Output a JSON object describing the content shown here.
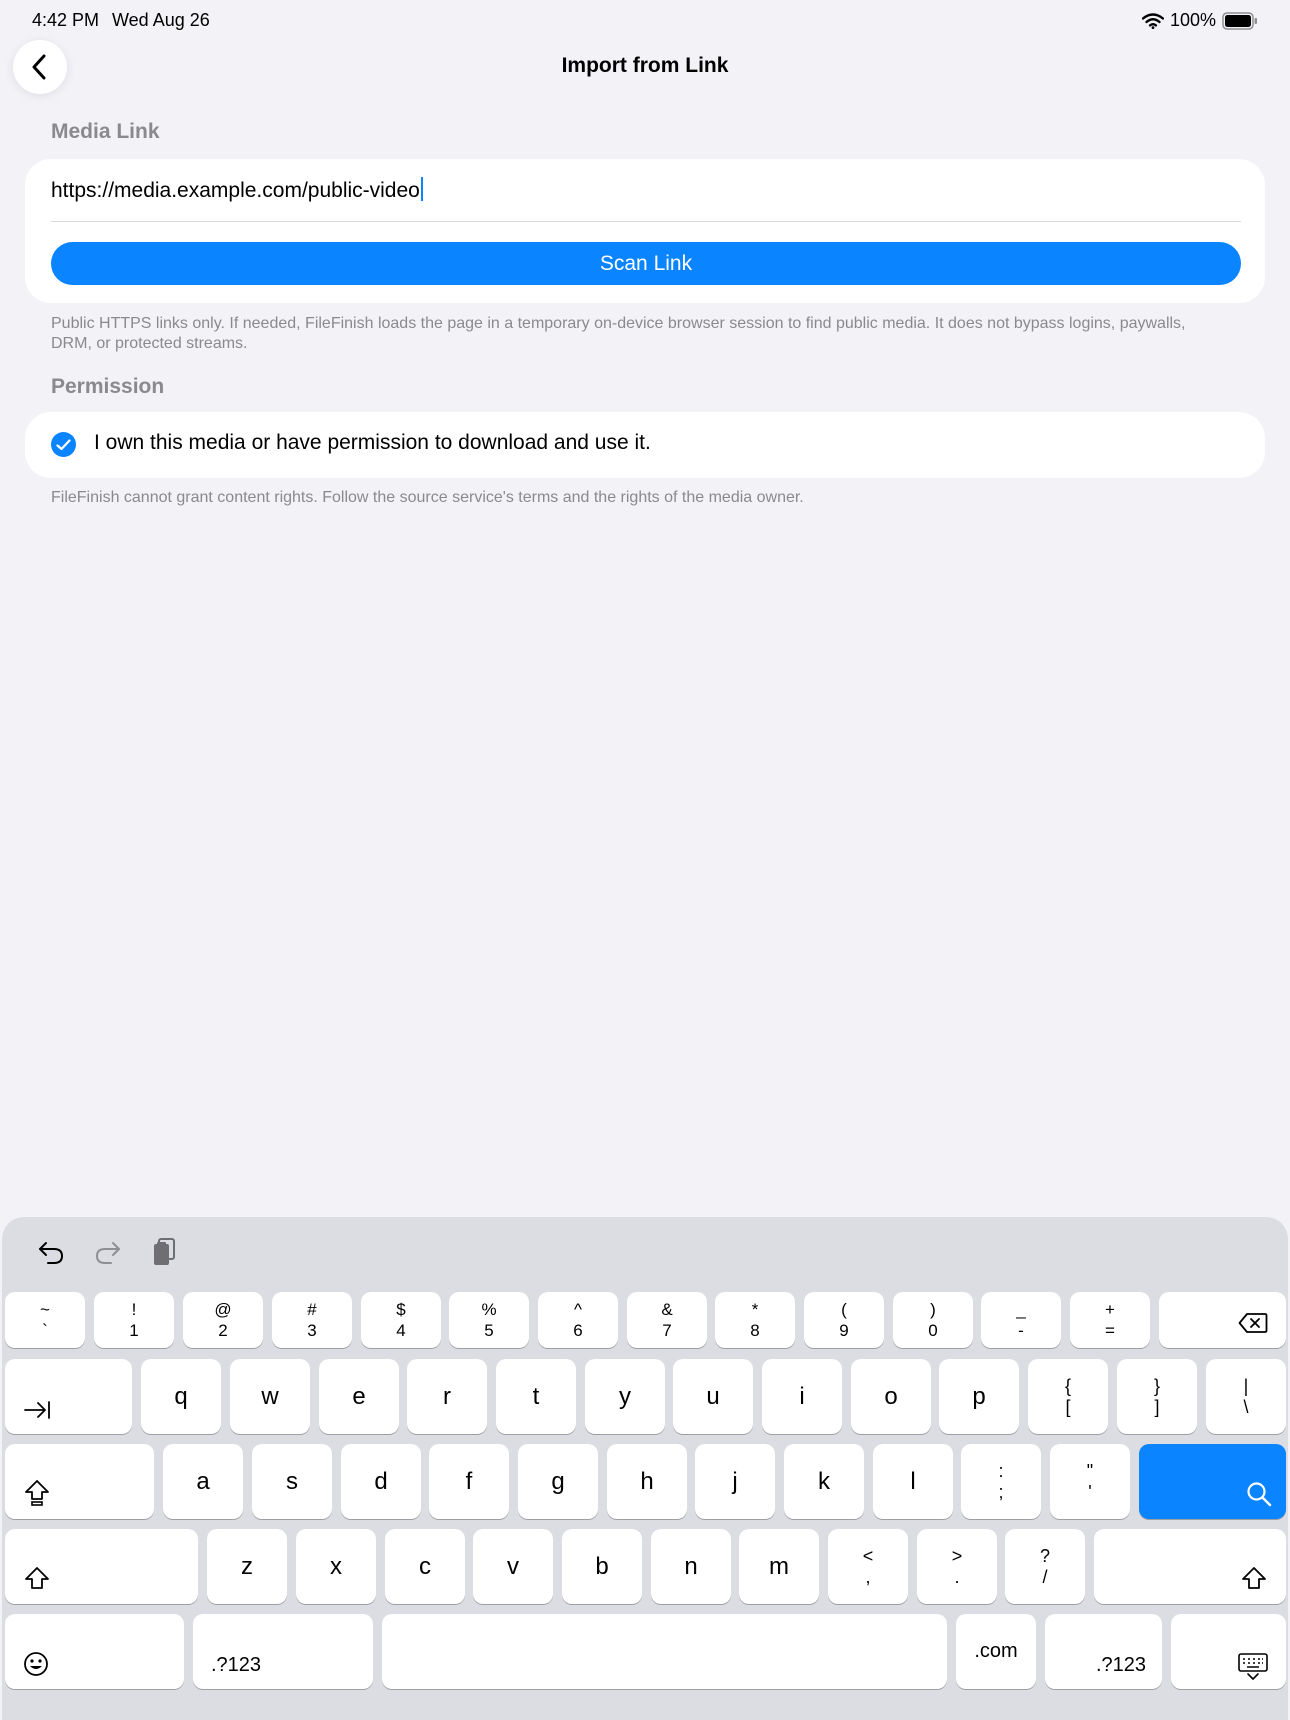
{
  "status_bar": {
    "time": "4:42 PM",
    "date": "Wed Aug 26",
    "battery": "100%",
    "icons": [
      "wifi-icon",
      "battery-icon"
    ]
  },
  "nav": {
    "title": "Import from Link",
    "back_icon": "chevron-left-icon"
  },
  "media_link": {
    "section_label": "Media Link",
    "url_value": "https://media.example.com/public-video",
    "scan_button": "Scan Link",
    "footnote": "Public HTTPS links only. If needed, FileFinish loads the page in a temporary on-device browser session to find public media. It does not bypass logins, paywalls, DRM, or protected streams."
  },
  "permission": {
    "section_label": "Permission",
    "checked": true,
    "checkbox_label": "I own this media or have permission to download and use it.",
    "footnote": "FileFinish cannot grant content rights. Follow the source service's terms and the rights of the media owner."
  },
  "keyboard": {
    "toolbar_icons": [
      "undo-icon",
      "redo-icon",
      "clipboard-icon"
    ],
    "row1": [
      {
        "top": "~",
        "bottom": "`"
      },
      {
        "top": "!",
        "bottom": "1"
      },
      {
        "top": "@",
        "bottom": "2"
      },
      {
        "top": "#",
        "bottom": "3"
      },
      {
        "top": "$",
        "bottom": "4"
      },
      {
        "top": "%",
        "bottom": "5"
      },
      {
        "top": "^",
        "bottom": "6"
      },
      {
        "top": "&",
        "bottom": "7"
      },
      {
        "top": "*",
        "bottom": "8"
      },
      {
        "top": "(",
        "bottom": "9"
      },
      {
        "top": ")",
        "bottom": "0"
      },
      {
        "top": "_",
        "bottom": "-"
      },
      {
        "top": "+",
        "bottom": "="
      }
    ],
    "row2": [
      "q",
      "w",
      "e",
      "r",
      "t",
      "y",
      "u",
      "i",
      "o",
      "p"
    ],
    "row2_symbols": [
      {
        "top": "{",
        "bottom": "["
      },
      {
        "top": "}",
        "bottom": "]"
      },
      {
        "top": "|",
        "bottom": "\\"
      }
    ],
    "row3": [
      "a",
      "s",
      "d",
      "f",
      "g",
      "h",
      "j",
      "k",
      "l"
    ],
    "row3_symbols": [
      {
        "top": ":",
        "bottom": ";"
      },
      {
        "top": "\"",
        "bottom": "'"
      }
    ],
    "row4": [
      "z",
      "x",
      "c",
      "v",
      "b",
      "n",
      "m"
    ],
    "row4_symbols": [
      {
        "top": "<",
        "bottom": ","
      },
      {
        "top": ">",
        "bottom": "."
      },
      {
        "top": "?",
        "bottom": "/"
      }
    ],
    "numbers_label": ".?123",
    "dotcom_label": ".com",
    "accent_color": "#0a84ff"
  }
}
